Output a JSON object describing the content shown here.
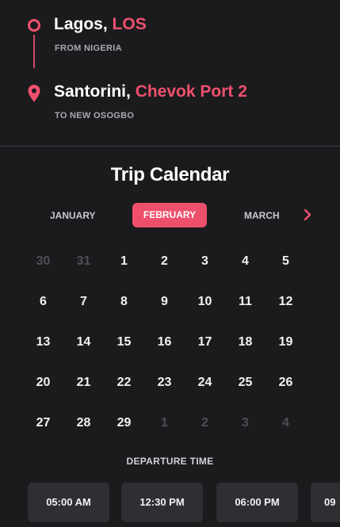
{
  "route": {
    "origin": {
      "city": "Lagos,",
      "code": "LOS",
      "subtitle": "FROM NIGERIA"
    },
    "destination": {
      "city": "Santorini,",
      "port": "Chevok Port 2",
      "subtitle": "TO NEW OSOGBO"
    }
  },
  "calendar": {
    "title": "Trip Calendar",
    "months": {
      "prev": "JANUARY",
      "active": "FEBRUARY",
      "next": "MARCH"
    },
    "days": [
      {
        "label": "30",
        "muted": true
      },
      {
        "label": "31",
        "muted": true
      },
      {
        "label": "1"
      },
      {
        "label": "2"
      },
      {
        "label": "3"
      },
      {
        "label": "4"
      },
      {
        "label": "5"
      },
      {
        "label": "6"
      },
      {
        "label": "7"
      },
      {
        "label": "8"
      },
      {
        "label": "9"
      },
      {
        "label": "10"
      },
      {
        "label": "11"
      },
      {
        "label": "12"
      },
      {
        "label": "13"
      },
      {
        "label": "14"
      },
      {
        "label": "15"
      },
      {
        "label": "16"
      },
      {
        "label": "17"
      },
      {
        "label": "18"
      },
      {
        "label": "19"
      },
      {
        "label": "20"
      },
      {
        "label": "21"
      },
      {
        "label": "22"
      },
      {
        "label": "23"
      },
      {
        "label": "24"
      },
      {
        "label": "25"
      },
      {
        "label": "26"
      },
      {
        "label": "27"
      },
      {
        "label": "28"
      },
      {
        "label": "29"
      },
      {
        "label": "1",
        "muted": true
      },
      {
        "label": "2",
        "muted": true
      },
      {
        "label": "3",
        "muted": true
      },
      {
        "label": "4",
        "muted": true
      }
    ]
  },
  "departure": {
    "label": "DEPARTURE TIME",
    "slots": [
      "05:00 AM",
      "12:30 PM",
      "06:00 PM",
      "09"
    ]
  },
  "colors": {
    "accent": "#ee506c",
    "background": "#1b1b1d",
    "slot": "#2e2e33",
    "muted": "#4e4e55"
  },
  "icons": {
    "origin": "circle-ring-icon",
    "destination": "map-pin-icon",
    "next": "chevron-right-icon"
  }
}
